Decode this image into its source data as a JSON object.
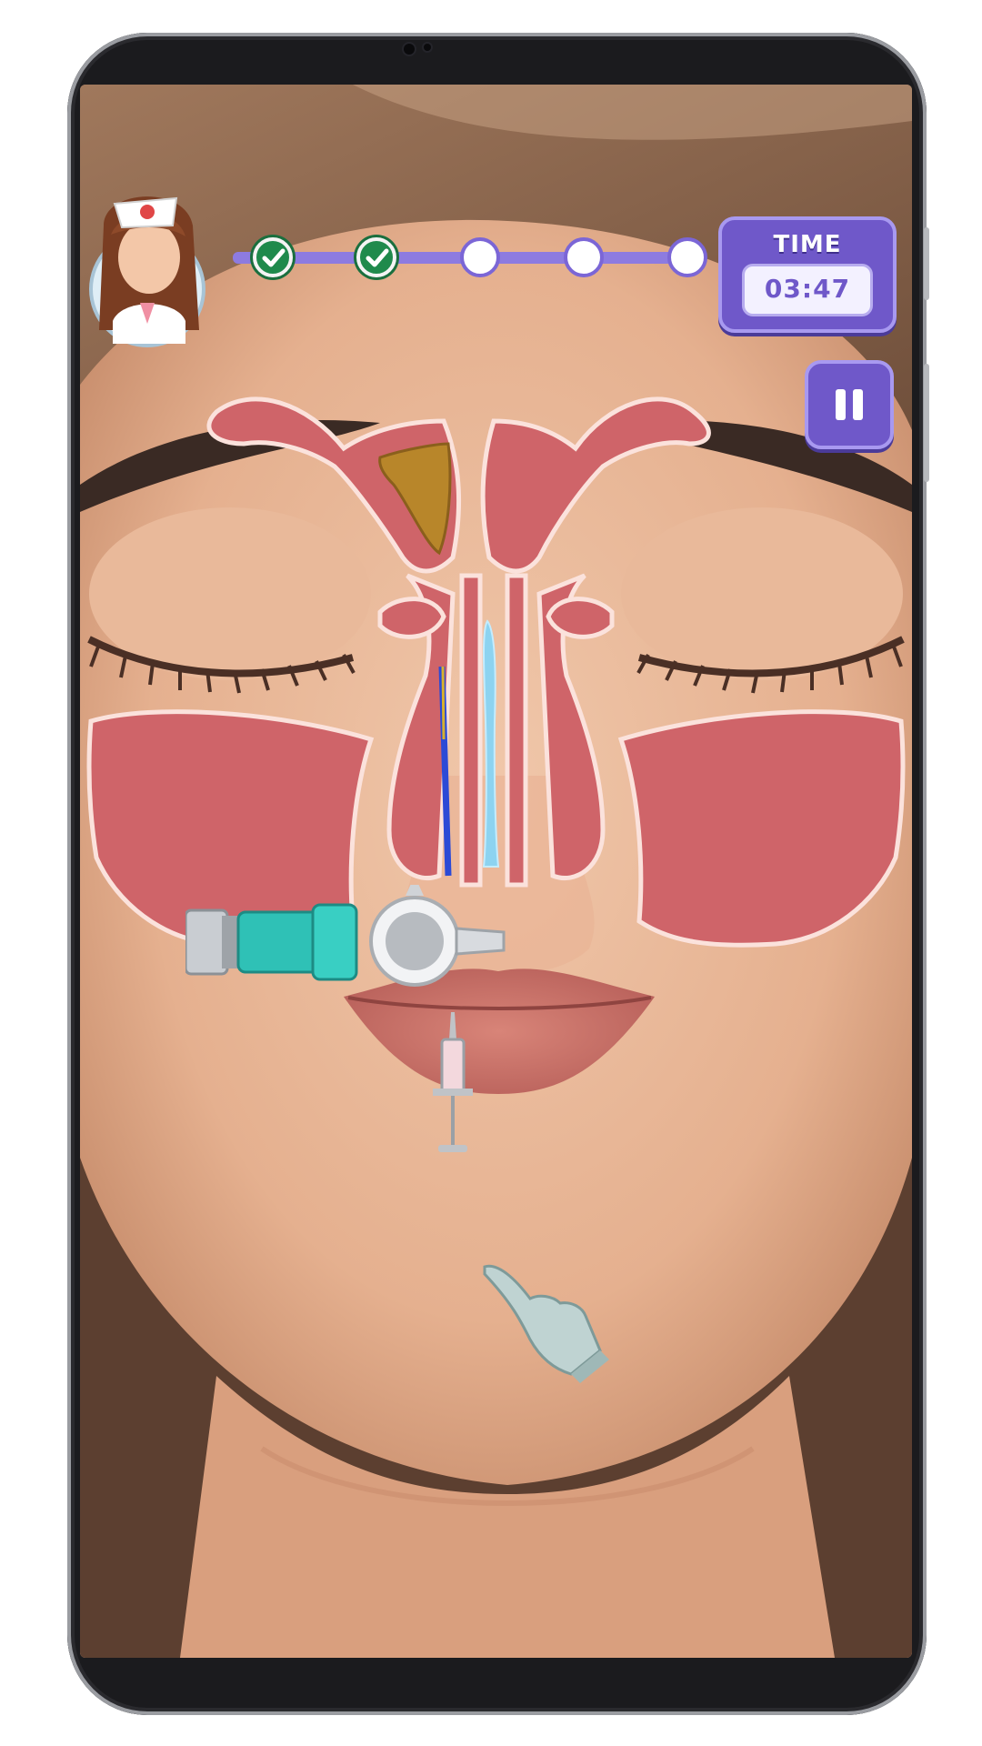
{
  "hud": {
    "time_label": "TIME",
    "time_value": "03:47",
    "progress_steps": [
      {
        "state": "completed"
      },
      {
        "state": "completed"
      },
      {
        "state": "pending"
      },
      {
        "state": "pending"
      },
      {
        "state": "pending"
      }
    ]
  },
  "icons": {
    "pause": "pause-icon",
    "check": "checkmark-icon",
    "nurse": "nurse-avatar-icon",
    "glove": "gloved-hand-icon"
  },
  "colors": {
    "hud_purple": "#6f58c9",
    "progress_done": "#1f8a4c",
    "sinus_tissue": "#cf6469",
    "mucus": "#b8862a",
    "skin": "#e7b596"
  }
}
